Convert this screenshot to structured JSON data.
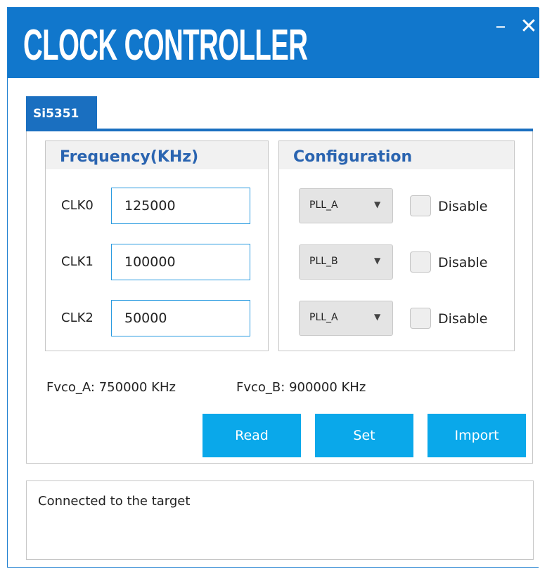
{
  "window": {
    "title": "CLOCK CONTROLLER",
    "minimize_symbol": "–",
    "close_symbol": "✕"
  },
  "tab": {
    "label": "Si5351",
    "active": true
  },
  "frequency_group": {
    "header": "Frequency(KHz)",
    "rows": [
      {
        "label": "CLK0",
        "value": "125000"
      },
      {
        "label": "CLK1",
        "value": "100000"
      },
      {
        "label": "CLK2",
        "value": "50000"
      }
    ]
  },
  "configuration_group": {
    "header": "Configuration",
    "rows": [
      {
        "pll": "PLL_A",
        "disable_label": "Disable",
        "disabled": false
      },
      {
        "pll": "PLL_B",
        "disable_label": "Disable",
        "disabled": false
      },
      {
        "pll": "PLL_A",
        "disable_label": "Disable",
        "disabled": false
      }
    ],
    "dropdown_arrow": "▼"
  },
  "fvco": {
    "a_label": "Fvco_A:",
    "a_value": "750000 KHz",
    "b_label": "Fvco_B:",
    "b_value": "900000 KHz"
  },
  "buttons": {
    "read": "Read",
    "set": "Set",
    "import": "Import"
  },
  "status": {
    "message": "Connected to the target"
  },
  "colors": {
    "title_bar": "#1177cc",
    "tab": "#1a6fc0",
    "button": "#0aa8ea",
    "group_header_text": "#2a64b0",
    "input_border": "#2a9be0"
  }
}
